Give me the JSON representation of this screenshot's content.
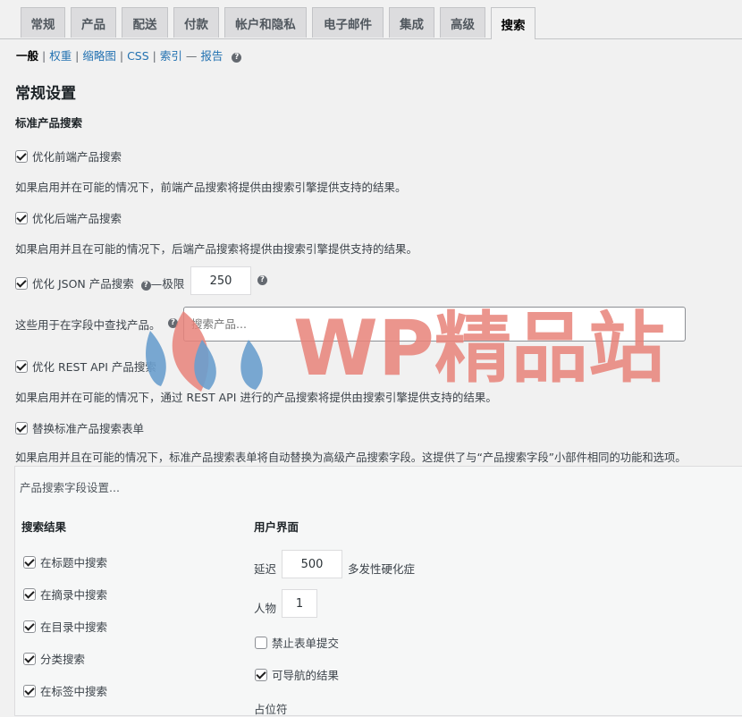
{
  "tabs": [
    "常规",
    "产品",
    "配送",
    "付款",
    "帐户和隐私",
    "电子邮件",
    "集成",
    "高级",
    "搜索"
  ],
  "subnav": {
    "current": "一般",
    "links": [
      "权重",
      "缩略图",
      "CSS",
      "索引"
    ],
    "dash": "—",
    "report": "报告"
  },
  "section_title": "常规设置",
  "group_title": "标准产品搜索",
  "options": {
    "frontend_label": "优化前端产品搜索",
    "frontend_desc": "如果启用并在可能的情况下，前端产品搜索将提供由搜索引擎提供支持的结果。",
    "backend_label": "优化后端产品搜索",
    "backend_desc": "如果启用并且在可能的情况下，后端产品搜索将提供由搜索引擎提供支持的结果。",
    "json_label": "优化 JSON 产品搜索",
    "json_limit_label": "—极限",
    "json_limit_value": "250",
    "field_desc": "这些用于在字段中查找产品。",
    "search_placeholder": "搜索产品...",
    "rest_label": "优化 REST API 产品搜索",
    "rest_desc": "如果启用并在可能的情况下，通过 REST API 进行的产品搜索将提供由搜索引擎提供支持的结果。",
    "replace_label": "替换标准产品搜索表单",
    "replace_desc": "如果启用并且在可能的情况下，标准产品搜索表单将自动替换为高级产品搜索字段。这提供了与“产品搜索字段”小部件相同的功能和选项。"
  },
  "panel": {
    "title": "产品搜索字段设置...",
    "results_heading": "搜索结果",
    "results_items": [
      "在标题中搜索",
      "在摘录中搜索",
      "在目录中搜索",
      "分类搜索",
      "在标签中搜索"
    ],
    "ui_heading": "用户界面",
    "delay_label": "延迟",
    "delay_value": "500",
    "delay_suffix": "多发性硬化症",
    "chars_label": "人物",
    "chars_value": "1",
    "disable_submit_label": "禁止表单提交",
    "navigable_label": "可导航的结果",
    "placeholder_label": "占位符"
  },
  "watermark_text": "WP精品站",
  "help_glyph": "?"
}
